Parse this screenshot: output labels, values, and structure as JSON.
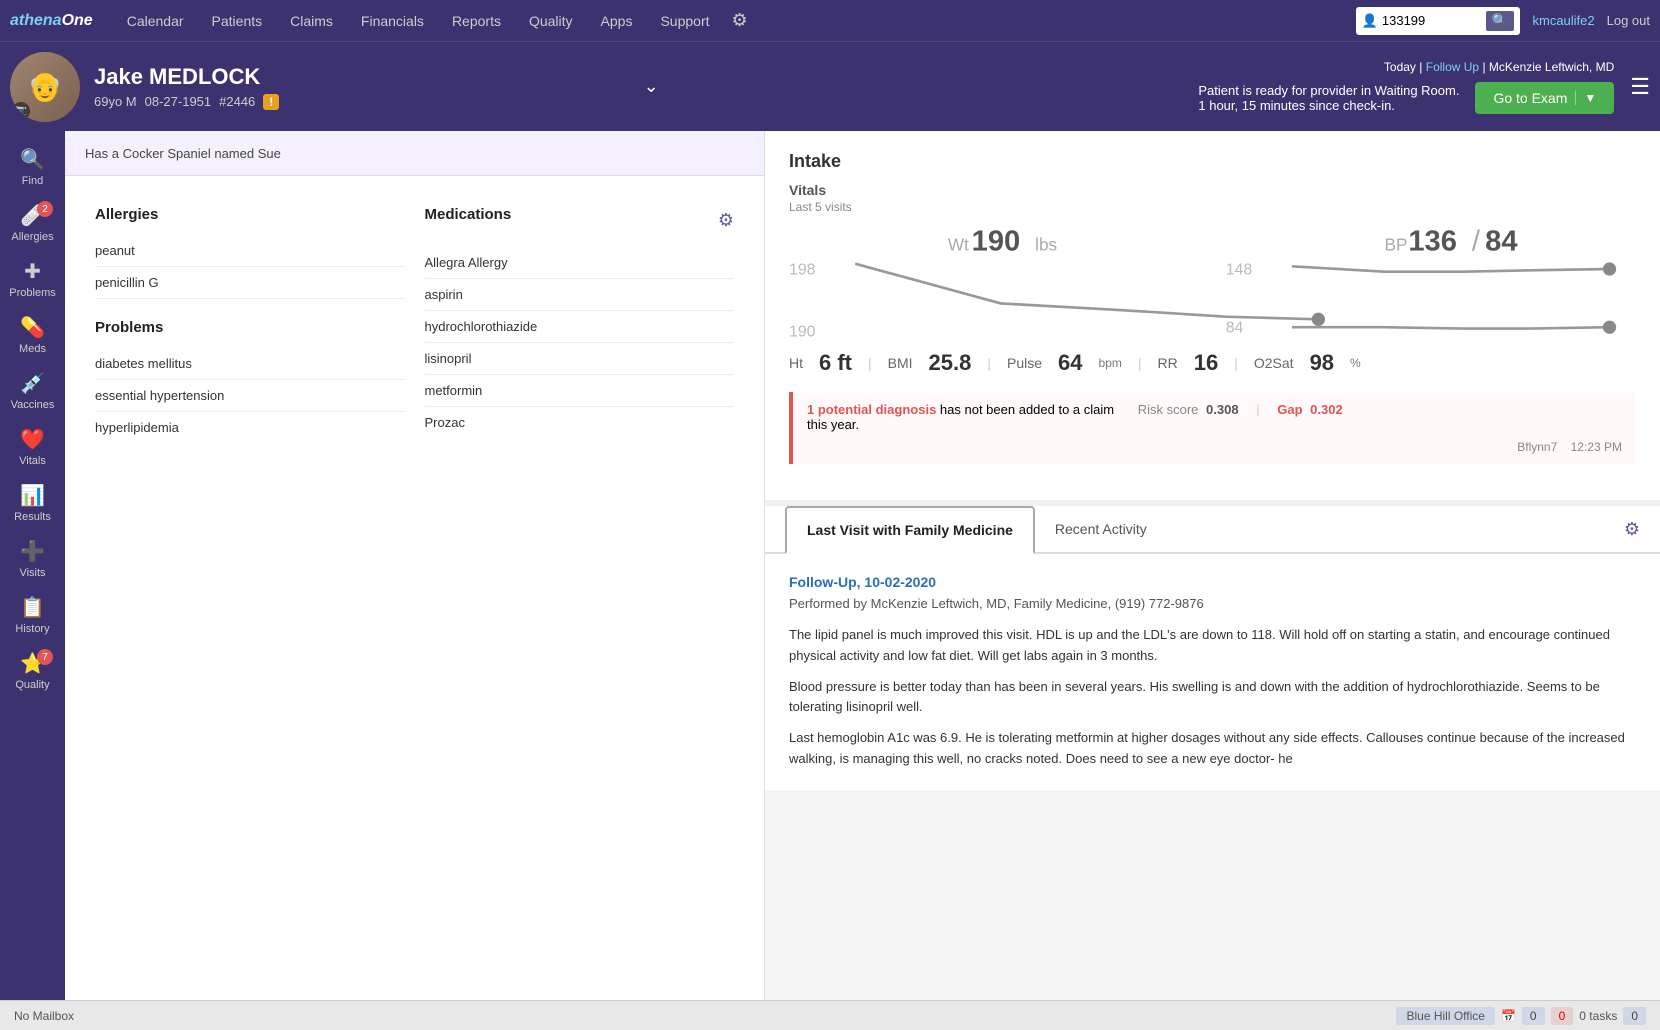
{
  "nav": {
    "logo": "athenaOne",
    "items": [
      "Calendar",
      "Patients",
      "Claims",
      "Financials",
      "Reports",
      "Quality",
      "Apps",
      "Support"
    ],
    "search_value": "133199",
    "user": "kmcaulife2",
    "logout": "Log out"
  },
  "patient": {
    "name": "Jake MEDLOCK",
    "age": "69yo M",
    "dob": "08-27-1951",
    "id": "#2446",
    "pet": "Has a Cocker Spaniel named Sue"
  },
  "header_right": {
    "today": "Today",
    "pipe1": "|",
    "follow_up": "Follow Up",
    "pipe2": "|",
    "provider": "McKenzie Leftwich, MD",
    "waiting_msg": "Patient is ready for provider in Waiting Room.",
    "checkin_msg": "1 hour, 15 minutes since check-in.",
    "go_exam": "Go to Exam"
  },
  "sidebar": {
    "items": [
      {
        "icon": "🔍",
        "label": "Find",
        "badge": null
      },
      {
        "icon": "🩹",
        "label": "Allergies",
        "badge": "2"
      },
      {
        "icon": "✚",
        "label": "Problems",
        "badge": null
      },
      {
        "icon": "💊",
        "label": "Meds",
        "badge": null
      },
      {
        "icon": "💉",
        "label": "Vaccines",
        "badge": null
      },
      {
        "icon": "❤️",
        "label": "Vitals",
        "badge": null
      },
      {
        "icon": "📊",
        "label": "Results",
        "badge": null
      },
      {
        "icon": "➕",
        "label": "Visits",
        "badge": null
      },
      {
        "icon": "📋",
        "label": "History",
        "badge": null
      },
      {
        "icon": "⭐",
        "label": "Quality",
        "badge": "7"
      }
    ]
  },
  "allergies": {
    "title": "Allergies",
    "items": [
      "peanut",
      "penicillin G"
    ]
  },
  "problems": {
    "title": "Problems",
    "items": [
      "diabetes mellitus",
      "essential hypertension",
      "hyperlipidemia"
    ]
  },
  "medications": {
    "title": "Medications",
    "items": [
      "Allegra Allergy",
      "aspirin",
      "hydrochlorothiazide",
      "lisinopril",
      "metformin",
      "Prozac"
    ]
  },
  "intake": {
    "title": "Intake",
    "vitals_title": "Vitals",
    "vitals_subtitle": "Last 5 visits",
    "wt_label": "Wt",
    "wt_value": "190",
    "wt_unit": "lbs",
    "bp_label": "BP",
    "bp_value": "136",
    "bp_sep": "/",
    "bp_value2": "84",
    "wt_high": "198",
    "wt_low": "190",
    "bp_high": "148",
    "bp_low": "84",
    "ht_label": "Ht",
    "ht_value": "6 ft",
    "bmi_label": "BMI",
    "bmi_value": "25.8",
    "pulse_label": "Pulse",
    "pulse_value": "64",
    "pulse_unit": "bpm",
    "rr_label": "RR",
    "rr_value": "16",
    "o2_label": "O2Sat",
    "o2_value": "98",
    "o2_unit": "%",
    "alert_link": "1 potential diagnosis",
    "alert_text": " has not been added to a claim",
    "alert_text2": "this year.",
    "risk_label": "Risk score",
    "risk_value": "0.308",
    "gap_label": "Gap",
    "gap_value": "0.302",
    "footer_user": "Bflynn7",
    "footer_time": "12:23 PM"
  },
  "tabs": {
    "tab1": "Last Visit with Family Medicine",
    "tab2": "Recent Activity",
    "gear_icon": "⚙️"
  },
  "visit": {
    "title": "Follow-Up, 10-02-2020",
    "subtitle": "Performed by McKenzie Leftwich, MD, Family Medicine, (919) 772-9876",
    "note_part1": "The lipid panel is much improved this visit. HDL is up and the LDL's are down to 118. Will hold off on starting a statin, and encourage continued physical activity and low fat diet. Will get labs again in 3 months.",
    "note_part2": "Blood pressure is better today than has been in several years. His swelling is and down with the addition of hydrochlorothiazide. Seems to be tolerating lisinopril well.",
    "note_part3": "Last hemoglobin A1c was 6.9. He is tolerating metformin at higher dosages without any side effects. Callouses continue because of the increased walking, is managing this well, no cracks noted. Does need to see a new eye doctor- he"
  },
  "status_bar": {
    "mailbox": "No Mailbox",
    "office": "Blue Hill Office",
    "counter1": "0",
    "counter2": "0",
    "tasks": "0 tasks",
    "counter3": "0"
  }
}
